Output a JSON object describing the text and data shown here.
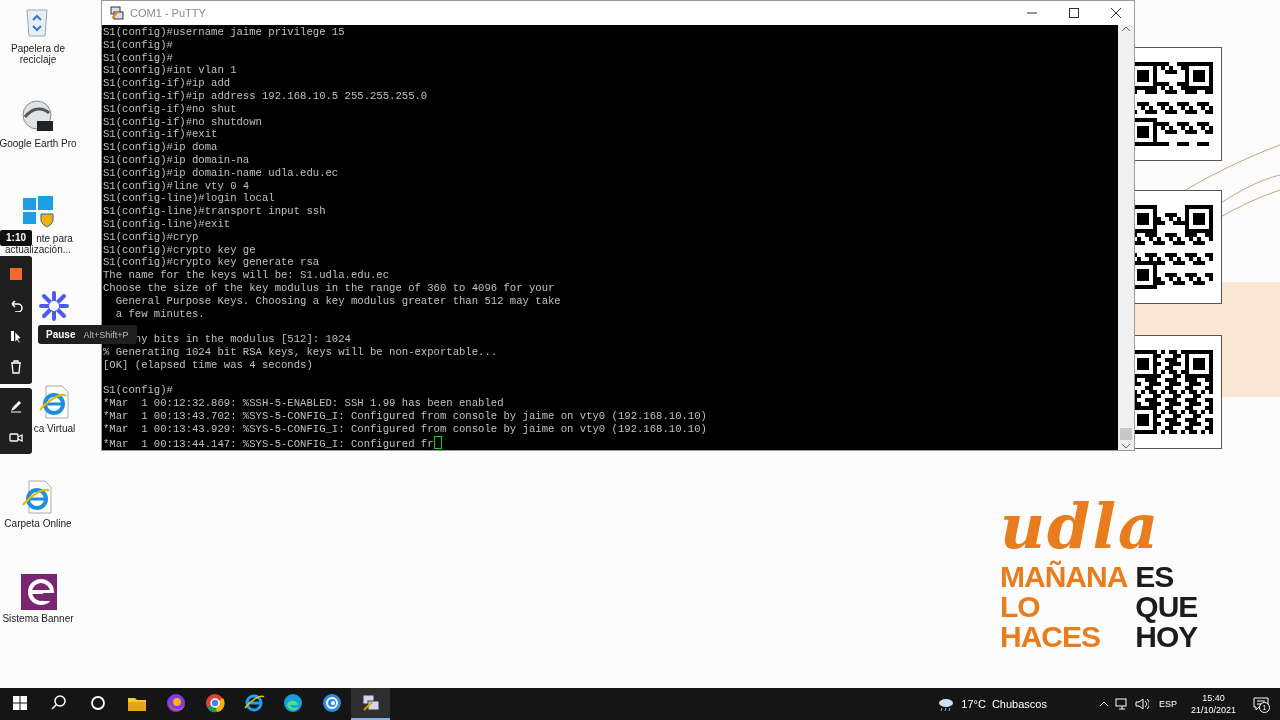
{
  "desktop_icons": [
    {
      "kind": "recycle-bin",
      "label": [
        {
          "kind": "line",
          "text": "Papelera de"
        },
        {
          "kind": "line",
          "text": "reciclaje"
        }
      ]
    },
    {
      "kind": "earth",
      "label": [
        {
          "kind": "line",
          "text": "Google Earth Pro"
        }
      ]
    },
    {
      "kind": "windows-update",
      "label": [
        {
          "kind": "covered",
          "text": "nte para"
        },
        {
          "kind": "line",
          "text": "actualización..."
        }
      ]
    },
    {
      "kind": "gear"
    },
    {
      "kind": "ie-doc",
      "label": [
        {
          "kind": "covered",
          "text": "ca Virtual"
        }
      ]
    },
    {
      "kind": "ie-doc",
      "label": [
        {
          "kind": "line",
          "text": "Carpeta Online"
        }
      ]
    },
    {
      "kind": "banner",
      "label": [
        {
          "kind": "line",
          "text": "Sistema Banner"
        }
      ]
    }
  ],
  "wallpaper": {
    "logo": "udla",
    "slogan": [
      {
        "text": "MAÑANA",
        "color": "#e87d1e"
      },
      {
        "text": "ES",
        "color": "#1c1c1c"
      },
      {
        "text": "LO",
        "color": "#e87d1e"
      },
      {
        "text": "QUE",
        "color": "#1c1c1c"
      },
      {
        "text": "HACES",
        "color": "#e87d1e"
      },
      {
        "text": "HOY",
        "color": "#1c1c1c"
      }
    ]
  },
  "window": {
    "title": "COM1 - PuTTY",
    "terminal": {
      "cursor": true,
      "lines": [
        {
          "kind": "line",
          "text": "S1(config)#username jaime privilege 15"
        },
        {
          "kind": "line",
          "text": "S1(config)#"
        },
        {
          "kind": "line",
          "text": "S1(config)#"
        },
        {
          "kind": "line",
          "text": "S1(config)#int vlan 1"
        },
        {
          "kind": "line",
          "text": "S1(config-if)#ip add"
        },
        {
          "kind": "line",
          "text": "S1(config-if)#ip address 192.168.10.5 255.255.255.0"
        },
        {
          "kind": "line",
          "text": "S1(config-if)#no shut"
        },
        {
          "kind": "line",
          "text": "S1(config-if)#no shutdown"
        },
        {
          "kind": "line",
          "text": "S1(config-if)#exit"
        },
        {
          "kind": "line",
          "text": "S1(config)#ip doma"
        },
        {
          "kind": "line",
          "text": "S1(config)#ip domain-na"
        },
        {
          "kind": "line",
          "text": "S1(config)#ip domain-name udla.edu.ec"
        },
        {
          "kind": "line",
          "text": "S1(config)#line vty 0 4"
        },
        {
          "kind": "line",
          "text": "S1(config-line)#login local"
        },
        {
          "kind": "line",
          "text": "S1(config-line)#transport input ssh"
        },
        {
          "kind": "line",
          "text": "S1(config-line)#exit"
        },
        {
          "kind": "line",
          "text": "S1(config)#cryp"
        },
        {
          "kind": "line",
          "text": "S1(config)#crypto key ge"
        },
        {
          "kind": "line",
          "text": "S1(config)#crypto key generate rsa"
        },
        {
          "kind": "line",
          "text": "The name for the keys will be: S1.udla.edu.ec"
        },
        {
          "kind": "line",
          "text": "Choose the size of the key modulus in the range of 360 to 4096 for your"
        },
        {
          "kind": "line",
          "text": "  General Purpose Keys. Choosing a key modulus greater than 512 may take"
        },
        {
          "kind": "line",
          "text": "  a few minutes."
        },
        {
          "kind": "blank"
        },
        {
          "kind": "covered",
          "text": "ny bits in the modulus [512]: 1024"
        },
        {
          "kind": "line",
          "text": "% Generating 1024 bit RSA keys, keys will be non-exportable..."
        },
        {
          "kind": "line",
          "text": "[OK] (elapsed time was 4 seconds)"
        },
        {
          "kind": "blank"
        },
        {
          "kind": "line",
          "text": "S1(config)#"
        },
        {
          "kind": "line",
          "text": "*Mar  1 00:12:32.869: %SSH-5-ENABLED: SSH 1.99 has been enabled"
        },
        {
          "kind": "line",
          "text": "*Mar  1 00:13:43.702: %SYS-5-CONFIG_I: Configured from console by jaime on vty0 (192.168.10.10)"
        },
        {
          "kind": "line",
          "text": "*Mar  1 00:13:43.929: %SYS-5-CONFIG_I: Configured from console by jaime on vty0 (192.168.10.10)"
        },
        {
          "kind": "line",
          "text": "*Mar  1 00:13:44.147: %SYS-5-CONFIG_I: Configured fr"
        }
      ]
    }
  },
  "recorder": {
    "timer": "1:10",
    "tooltip": {
      "label": "Pause",
      "shortcut": "Alt+Shift+P"
    }
  },
  "taskbar": {
    "apps": [
      {
        "kind": "explorer",
        "active": false
      },
      {
        "kind": "firefox",
        "active": false
      },
      {
        "kind": "chrome",
        "active": false
      },
      {
        "kind": "ie",
        "active": false
      },
      {
        "kind": "edge",
        "active": false
      },
      {
        "kind": "swirl",
        "active": false
      },
      {
        "kind": "putty",
        "active": true
      }
    ],
    "temperature": "17°C",
    "condition": "Chubascos",
    "language": "ESP",
    "time": "15:40",
    "date": "21/10/2021",
    "notifications": "1"
  }
}
